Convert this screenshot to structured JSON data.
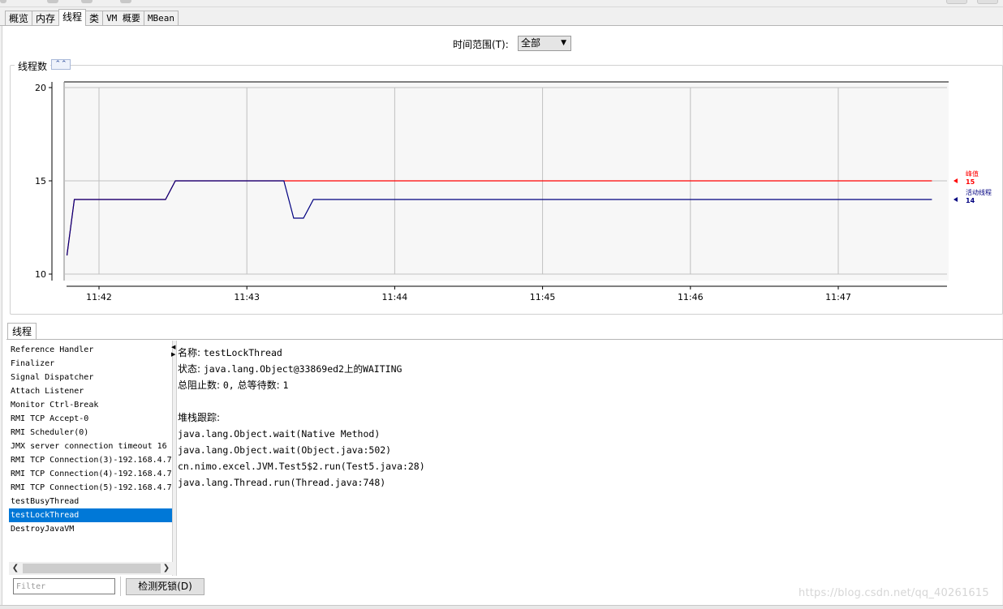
{
  "tabs": [
    {
      "label": "概览",
      "active": false,
      "mono": false
    },
    {
      "label": "内存",
      "active": false,
      "mono": false
    },
    {
      "label": "线程",
      "active": true,
      "mono": false
    },
    {
      "label": "类",
      "active": false,
      "mono": false
    },
    {
      "label": "VM 概要",
      "active": false,
      "mono": true
    },
    {
      "label": "MBean",
      "active": false,
      "mono": true
    }
  ],
  "time_range": {
    "label": "时间范围(T):",
    "value": "全部"
  },
  "chart_panel": {
    "title": "线程数",
    "collapse_icon": "double-chevron-up-icon"
  },
  "chart_data": {
    "type": "line",
    "ylim": [
      10,
      20
    ],
    "y_ticks": [
      "20",
      "15",
      "10"
    ],
    "x_ticks": [
      "11:42",
      "11:43",
      "11:44",
      "11:45",
      "11:46",
      "11:47"
    ],
    "series": [
      {
        "name": "峰值",
        "color": "#ff0000",
        "current": "15",
        "points": [
          [
            "11:41:47",
            11
          ],
          [
            "11:41:50",
            14
          ],
          [
            "11:42:27",
            14
          ],
          [
            "11:42:31",
            15
          ],
          [
            "11:47:38",
            15
          ]
        ]
      },
      {
        "name": "活动线程",
        "color": "#000080",
        "current": "14",
        "points": [
          [
            "11:41:47",
            11
          ],
          [
            "11:41:50",
            14
          ],
          [
            "11:42:27",
            14
          ],
          [
            "11:42:31",
            15
          ],
          [
            "11:43:15",
            15
          ],
          [
            "11:43:19",
            13
          ],
          [
            "11:43:23",
            13
          ],
          [
            "11:43:27",
            14
          ],
          [
            "11:47:38",
            14
          ]
        ]
      }
    ]
  },
  "thread_tab": {
    "label": "线程"
  },
  "threads": [
    {
      "name": "Reference Handler",
      "selected": false
    },
    {
      "name": "Finalizer",
      "selected": false
    },
    {
      "name": "Signal Dispatcher",
      "selected": false
    },
    {
      "name": "Attach Listener",
      "selected": false
    },
    {
      "name": "Monitor Ctrl-Break",
      "selected": false
    },
    {
      "name": "RMI TCP Accept-0",
      "selected": false
    },
    {
      "name": "RMI Scheduler(0)",
      "selected": false
    },
    {
      "name": "JMX server connection timeout 16",
      "selected": false
    },
    {
      "name": "RMI TCP Connection(3)-192.168.4.7",
      "selected": false
    },
    {
      "name": "RMI TCP Connection(4)-192.168.4.7",
      "selected": false
    },
    {
      "name": "RMI TCP Connection(5)-192.168.4.7",
      "selected": false
    },
    {
      "name": "testBusyThread",
      "selected": false
    },
    {
      "name": "testLockThread",
      "selected": true
    },
    {
      "name": "DestroyJavaVM",
      "selected": false
    }
  ],
  "details": {
    "name_label": "名称:",
    "name_value": "testLockThread",
    "state_label": "状态:",
    "state_value": "java.lang.Object@33869ed2上的WAITING",
    "counts_label": "总阻止数:",
    "blocked_value": "0,",
    "waited_label": "总等待数:",
    "waited_value": "1",
    "stack_label": "堆栈跟踪:",
    "stack": [
      "java.lang.Object.wait(Native Method)",
      "java.lang.Object.wait(Object.java:502)",
      "cn.nimo.excel.JVM.Test5$2.run(Test5.java:28)",
      "java.lang.Thread.run(Thread.java:748)"
    ]
  },
  "filter": {
    "placeholder": "Filter"
  },
  "deadlock_button": {
    "label": "检测死锁(D)"
  },
  "watermark": "https://blog.csdn.net/qq_40261615"
}
